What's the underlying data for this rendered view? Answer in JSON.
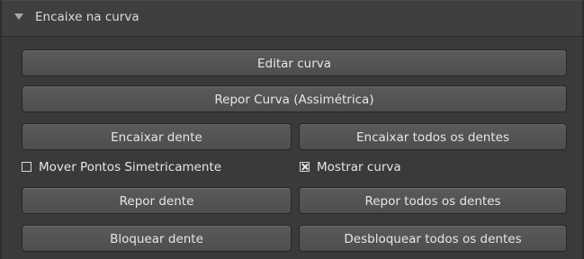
{
  "header": {
    "title": "Encaixe na curva",
    "collapse_icon": "triangle-down-icon"
  },
  "buttons": {
    "edit_curve": "Editar curva",
    "reset_curve": "Repor Curva (Assimétrica)",
    "fit_tooth": "Encaixar dente",
    "fit_all_teeth": "Encaixar todos os dentes",
    "reset_tooth": "Repor dente",
    "reset_all_teeth": "Repor todos os dentes",
    "lock_tooth": "Bloquear dente",
    "unlock_all_teeth": "Desbloquear todos os dentes"
  },
  "checkboxes": {
    "move_points_symmetric": {
      "label": "Mover Pontos Simetricamente",
      "checked": false
    },
    "show_curve": {
      "label": "Mostrar curva",
      "checked": true
    }
  },
  "colors": {
    "panel_bg": "#3a3a3a",
    "button_bg": "#555555",
    "text": "#e6e6e6"
  }
}
